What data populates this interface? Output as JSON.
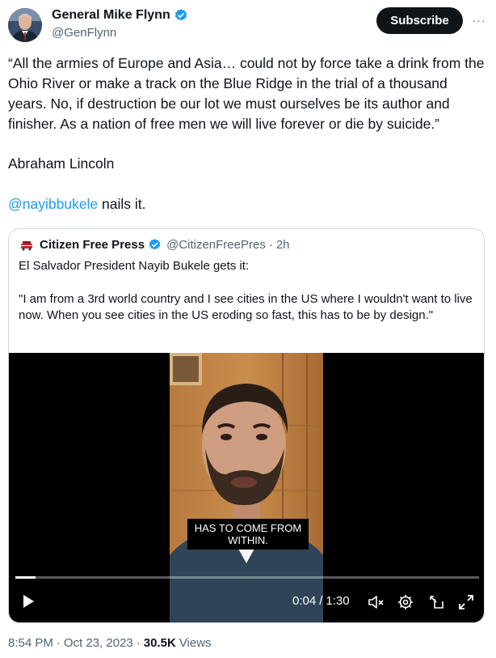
{
  "author": {
    "display_name": "General Mike Flynn",
    "handle": "@GenFlynn",
    "verified": true
  },
  "actions": {
    "subscribe_label": "Subscribe",
    "more_label": "···"
  },
  "tweet": {
    "text": "“All the armies of Europe and Asia… could not by force take a drink from the Ohio River or make a track on the Blue Ridge in the trial of a thousand years. No, if destruction be our lot we must ourselves be its author and finisher. As a nation of free men we will live forever or die by suicide.”",
    "attribution": "Abraham Lincoln",
    "mention": "@nayibbukele",
    "mention_suffix": " nails it."
  },
  "quoted": {
    "display_name": "Citizen Free Press",
    "handle": "@CitizenFreePres",
    "separator": "·",
    "time_ago": "2h",
    "verified": true,
    "text_line1": "El Salvador President Nayib Bukele gets it:",
    "text_line2": "\"I am from a 3rd world country and I see cities in the US where I wouldn't want to live now. When you see cities in the US eroding so fast, this has to be by design.\""
  },
  "video": {
    "caption": "HAS TO COME FROM WITHIN.",
    "current_time": "0:04",
    "time_sep": "/",
    "duration": "1:30",
    "progress_fraction": 0.044,
    "controls": [
      "play-icon",
      "mute-icon",
      "settings-icon",
      "pip-icon",
      "fullscreen-icon"
    ]
  },
  "meta": {
    "time": "8:54 PM",
    "sep1": "·",
    "date": "Oct 23, 2023",
    "sep2": "·",
    "views_count": "30.5K",
    "views_label": "Views"
  },
  "colors": {
    "link": "#1d9bf0",
    "verified": "#1d9bf0",
    "text": "#0f1419",
    "muted": "#536471",
    "border": "#cfd9de"
  }
}
